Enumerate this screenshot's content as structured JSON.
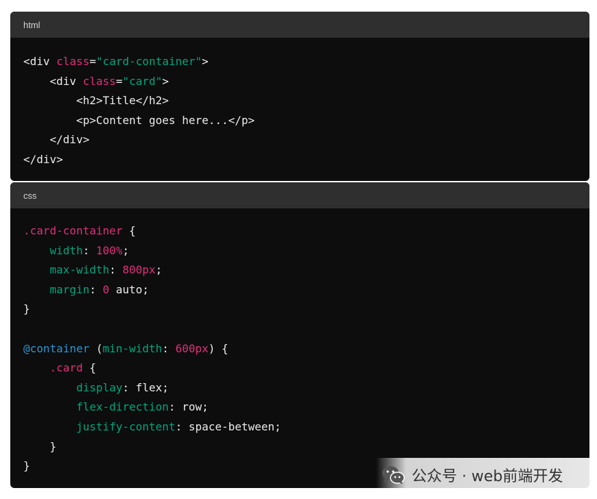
{
  "html_block": {
    "language": "html",
    "lines": [
      [
        {
          "t": "<div ",
          "c": "plain"
        },
        {
          "t": "class",
          "c": "attr"
        },
        {
          "t": "=",
          "c": "plain"
        },
        {
          "t": "\"card-container\"",
          "c": "str"
        },
        {
          "t": ">",
          "c": "plain"
        }
      ],
      [
        {
          "t": "    <div ",
          "c": "plain"
        },
        {
          "t": "class",
          "c": "attr"
        },
        {
          "t": "=",
          "c": "plain"
        },
        {
          "t": "\"card\"",
          "c": "str"
        },
        {
          "t": ">",
          "c": "plain"
        }
      ],
      [
        {
          "t": "        <h2>Title</h2>",
          "c": "plain"
        }
      ],
      [
        {
          "t": "        <p>Content goes here...</p>",
          "c": "plain"
        }
      ],
      [
        {
          "t": "    </div>",
          "c": "plain"
        }
      ],
      [
        {
          "t": "</div>",
          "c": "plain"
        }
      ]
    ]
  },
  "css_block": {
    "language": "css",
    "lines": [
      [
        {
          "t": ".card-container",
          "c": "sel"
        },
        {
          "t": " {",
          "c": "plain"
        }
      ],
      [
        {
          "t": "    ",
          "c": "plain"
        },
        {
          "t": "width",
          "c": "prop"
        },
        {
          "t": ": ",
          "c": "plain"
        },
        {
          "t": "100%",
          "c": "num"
        },
        {
          "t": ";",
          "c": "plain"
        }
      ],
      [
        {
          "t": "    ",
          "c": "plain"
        },
        {
          "t": "max-width",
          "c": "prop"
        },
        {
          "t": ": ",
          "c": "plain"
        },
        {
          "t": "800px",
          "c": "num"
        },
        {
          "t": ";",
          "c": "plain"
        }
      ],
      [
        {
          "t": "    ",
          "c": "plain"
        },
        {
          "t": "margin",
          "c": "prop"
        },
        {
          "t": ": ",
          "c": "plain"
        },
        {
          "t": "0",
          "c": "num"
        },
        {
          "t": " auto;",
          "c": "plain"
        }
      ],
      [
        {
          "t": "}",
          "c": "plain"
        }
      ],
      [
        {
          "t": "",
          "c": "plain"
        }
      ],
      [
        {
          "t": "@container",
          "c": "at"
        },
        {
          "t": " (",
          "c": "plain"
        },
        {
          "t": "min-width",
          "c": "prop"
        },
        {
          "t": ": ",
          "c": "plain"
        },
        {
          "t": "600px",
          "c": "num"
        },
        {
          "t": ") {",
          "c": "plain"
        }
      ],
      [
        {
          "t": "    ",
          "c": "plain"
        },
        {
          "t": ".card",
          "c": "sel"
        },
        {
          "t": " {",
          "c": "plain"
        }
      ],
      [
        {
          "t": "        ",
          "c": "plain"
        },
        {
          "t": "display",
          "c": "prop"
        },
        {
          "t": ": flex;",
          "c": "plain"
        }
      ],
      [
        {
          "t": "        ",
          "c": "plain"
        },
        {
          "t": "flex-direction",
          "c": "prop"
        },
        {
          "t": ": row;",
          "c": "plain"
        }
      ],
      [
        {
          "t": "        ",
          "c": "plain"
        },
        {
          "t": "justify-content",
          "c": "prop"
        },
        {
          "t": ": space-between;",
          "c": "plain"
        }
      ],
      [
        {
          "t": "    }",
          "c": "plain"
        }
      ],
      [
        {
          "t": "}",
          "c": "plain"
        }
      ]
    ]
  },
  "watermark": {
    "icon": "wechat-icon",
    "text": "公众号 · web前端开发"
  },
  "colors": {
    "code_background": "#0d0d0d",
    "header_background": "#2f2f2f",
    "plain": "#ececec",
    "attr": "#df3079",
    "string": "#00a67d",
    "selector": "#df3079",
    "property": "#00a67d",
    "number": "#df3079",
    "at_rule": "#2e95d3"
  }
}
